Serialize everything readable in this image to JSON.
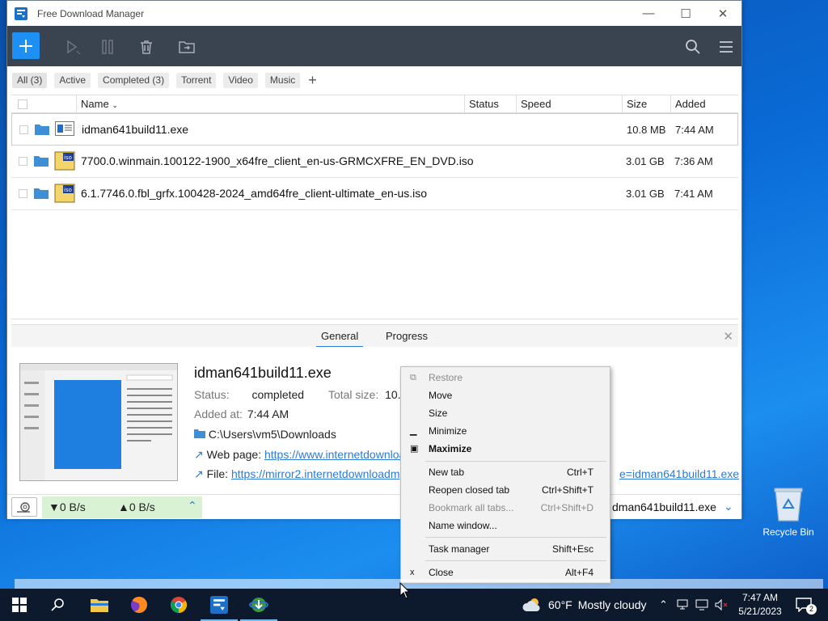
{
  "window": {
    "title": "Free Download Manager",
    "controls": {
      "minimize": "—",
      "maximize": "☐",
      "close": "✕"
    }
  },
  "filters": {
    "chips": [
      "All (3)",
      "Active",
      "Completed (3)",
      "Torrent",
      "Video",
      "Music"
    ],
    "add": "+"
  },
  "columns": {
    "name": "Name",
    "status": "Status",
    "speed": "Speed",
    "size": "Size",
    "added": "Added"
  },
  "downloads": [
    {
      "name": "idman641build11.exe",
      "size": "10.8 MB",
      "added": "7:44 AM",
      "icon": "exe-file-icon"
    },
    {
      "name": "7700.0.winmain.100122-1900_x64fre_client_en-us-GRMCXFRE_EN_DVD.iso",
      "size": "3.01 GB",
      "added": "7:36 AM",
      "icon": "iso-file-icon"
    },
    {
      "name": "6.1.7746.0.fbl_grfx.100428-2024_amd64fre_client-ultimate_en-us.iso",
      "size": "3.01 GB",
      "added": "7:41 AM",
      "icon": "iso-file-icon"
    }
  ],
  "details": {
    "tabs": {
      "general": "General",
      "progress": "Progress"
    },
    "title": "idman641build11.exe",
    "status_label": "Status:",
    "status_value": "completed",
    "total_label": "Total size:",
    "total_value": "10.8",
    "added_label": "Added at:",
    "added_value": "7:44 AM",
    "folder": "C:\\Users\\vm5\\Downloads",
    "web_label": "Web page:",
    "web_url": "https://www.internetdownloa",
    "file_label": "File:",
    "file_url": "https://mirror2.internetdownloadm",
    "file_url_tail": "e=idman641build11.exe"
  },
  "statusbar": {
    "down": "▼0 B/s",
    "up": "▲0 B/s",
    "file": "dman641build11.exe"
  },
  "context_menu": {
    "items": [
      {
        "label": "Restore",
        "shortcut": "",
        "disabled": true
      },
      {
        "label": "Move",
        "shortcut": ""
      },
      {
        "label": "Size",
        "shortcut": ""
      },
      {
        "label": "Minimize",
        "shortcut": ""
      },
      {
        "label": "Maximize",
        "shortcut": ""
      },
      {
        "label": "New tab",
        "shortcut": "Ctrl+T"
      },
      {
        "label": "Reopen closed tab",
        "shortcut": "Ctrl+Shift+T"
      },
      {
        "label": "Bookmark all tabs...",
        "shortcut": "Ctrl+Shift+D",
        "disabled": true
      },
      {
        "label": "Name window...",
        "shortcut": ""
      },
      {
        "label": "Task manager",
        "shortcut": "Shift+Esc"
      },
      {
        "label": "Close",
        "shortcut": "Alt+F4"
      }
    ]
  },
  "desktop": {
    "recycle_bin": "Recycle Bin"
  },
  "taskbar": {
    "weather_temp": "60°F",
    "weather_text": "Mostly cloudy",
    "time": "7:47 AM",
    "date": "5/21/2023",
    "notifications": "2"
  },
  "colors": {
    "accent": "#1e8ff3",
    "toolbar": "#3a4350",
    "link": "#2d7bd4",
    "speed_bg": "#d9f2d4"
  }
}
